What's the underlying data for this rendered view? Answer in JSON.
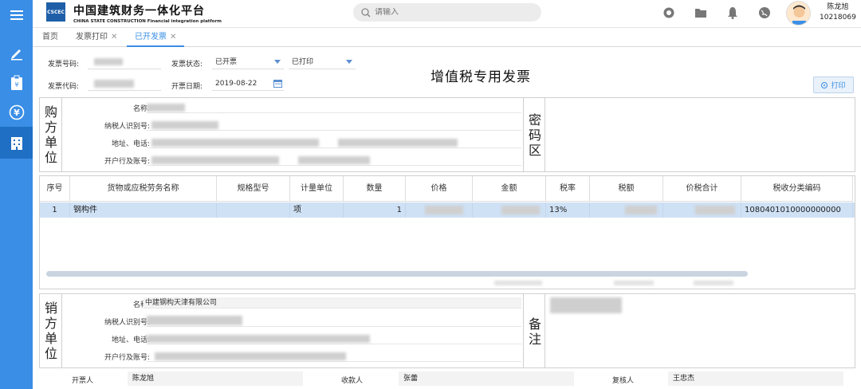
{
  "header": {
    "logo_text": "CSCEC",
    "brand_cn": "中国建筑财务一体化平台",
    "brand_en": "CHINA STATE CONSTRUCTION Financial integration platform",
    "search_placeholder": "请输入",
    "user_name": "陈龙旭",
    "user_id": "10218069"
  },
  "sidebar": {
    "items": [
      "menu-icon",
      "edit-icon",
      "clipboard-icon",
      "yuan-icon",
      "building-icon"
    ],
    "active_index": 4
  },
  "tabs": [
    {
      "label": "首页",
      "closable": false,
      "active": false
    },
    {
      "label": "发票打印",
      "closable": true,
      "active": false
    },
    {
      "label": "已开发票",
      "closable": true,
      "active": true
    }
  ],
  "form": {
    "invoice_no_label": "发票号码:",
    "invoice_code_label": "发票代码:",
    "status_label": "发票状态:",
    "status_value": "已开票",
    "print_status_value": "已打印",
    "date_label": "开票日期:",
    "date_value": "2019-08-22"
  },
  "title": "增值税专用发票",
  "print_button": "打印",
  "buyer": {
    "side_label": "购方单位",
    "name_label": "名称:",
    "tax_id_label": "纳税人识别号:",
    "address_label": "地址、电话:",
    "bank_label": "开户行及账号:"
  },
  "cipher_label": "密码区",
  "table": {
    "headers": [
      "序号",
      "货物或应税劳务名称",
      "规格型号",
      "计量单位",
      "数量",
      "价格",
      "金额",
      "税率",
      "税额",
      "价税合计",
      "税收分类编码"
    ],
    "rows": [
      {
        "seq": "1",
        "name": "钢构件",
        "spec": "",
        "unit": "项",
        "qty": "1",
        "price": "",
        "amount": "",
        "rate": "13%",
        "tax": "",
        "total": "",
        "code": "1080401010000000000"
      }
    ]
  },
  "seller": {
    "side_label": "销方单位",
    "name_label": "名称:",
    "name_value": "中建钢构天津有限公司",
    "tax_id_label": "纳税人识别号:",
    "address_label": "地址、电话:",
    "bank_label": "开户行及账号:"
  },
  "remark_label": "备注",
  "footer": {
    "issuer_label": "开票人",
    "issuer_value": "陈龙旭",
    "payee_label": "收款人",
    "payee_value": "张蕾",
    "reviewer_label": "复核人",
    "reviewer_value": "王忠杰"
  },
  "colors": {
    "sidebar": "#3a8ee6",
    "accent": "#3a8ee6",
    "row_selected": "#cfe1f5"
  }
}
